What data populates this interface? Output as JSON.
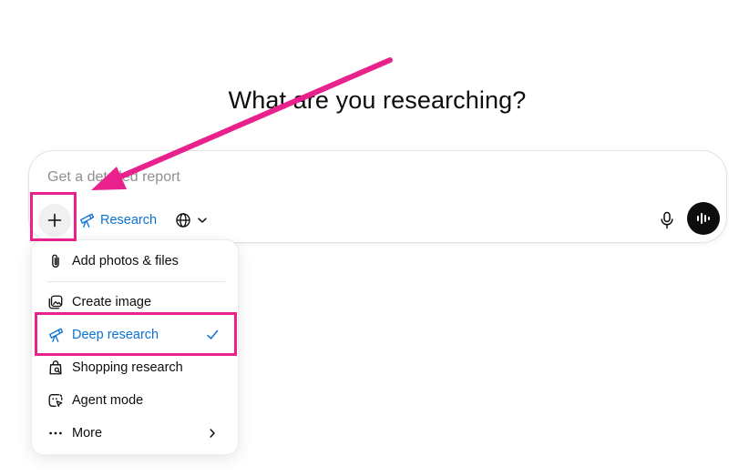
{
  "heading": "What are you researching?",
  "composer": {
    "placeholder": "Get a detailed report",
    "research_label": "Research",
    "icons": {
      "plus": "plus-icon",
      "research": "telescope-icon",
      "globe": "globe-icon",
      "chevron": "chevron-down-icon",
      "mic": "microphone-icon",
      "voice": "voice-waveform-icon"
    }
  },
  "menu": {
    "items": [
      {
        "label": "Add photos & files",
        "icon": "paperclip-icon"
      },
      {
        "label": "Create image",
        "icon": "image-icon"
      },
      {
        "label": "Deep research",
        "icon": "telescope-icon",
        "selected": true
      },
      {
        "label": "Shopping research",
        "icon": "shopping-bag-icon"
      },
      {
        "label": "Agent mode",
        "icon": "agent-icon"
      },
      {
        "label": "More",
        "icon": "ellipsis-icon",
        "submenu": true
      }
    ]
  },
  "annotations": {
    "highlight_color": "#e8218c"
  },
  "colors": {
    "accent": "#0a72d6",
    "text": "#0d0d0d",
    "placeholder": "#8f8f8f"
  }
}
